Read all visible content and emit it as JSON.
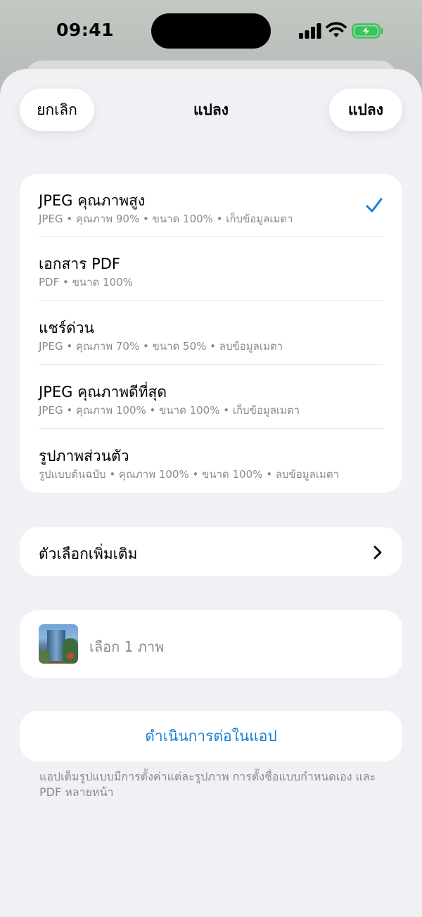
{
  "status_bar": {
    "time": "09:41"
  },
  "header": {
    "cancel_label": "ยกเลิก",
    "title": "แปลง",
    "convert_label": "แปลง"
  },
  "presets": [
    {
      "title": "JPEG คุณภาพสูง",
      "subtitle": "JPEG • คุณภาพ 90% • ขนาด 100% • เก็บข้อมูลเมตา",
      "selected": true
    },
    {
      "title": "เอกสาร PDF",
      "subtitle": "PDF • ขนาด 100%",
      "selected": false
    },
    {
      "title": "แชร์ด่วน",
      "subtitle": "JPEG • คุณภาพ 70% • ขนาด 50% • ลบข้อมูลเมตา",
      "selected": false
    },
    {
      "title": "JPEG คุณภาพดีที่สุด",
      "subtitle": "JPEG • คุณภาพ 100% • ขนาด 100% • เก็บข้อมูลเมตา",
      "selected": false
    },
    {
      "title": "รูปภาพส่วนตัว",
      "subtitle": "รูปแบบต้นฉบับ • คุณภาพ 100% • ขนาด 100% • ลบข้อมูลเมตา",
      "selected": false
    }
  ],
  "more_options": {
    "label": "ตัวเลือกเพิ่มเติม"
  },
  "selection": {
    "label": "เลือก 1 ภาพ"
  },
  "continue": {
    "label": "ดำเนินการต่อในแอป"
  },
  "footnote": "แอปเต็มรูปแบบมีการตั้งค่าแต่ละรูปภาพ การตั้งชื่อแบบกำหนดเอง และ PDF หลายหน้า",
  "colors": {
    "accent": "#1b7fd6",
    "battery": "#34c759"
  },
  "icons": {
    "check": "checkmark-icon",
    "chevron": "chevron-right-icon"
  }
}
